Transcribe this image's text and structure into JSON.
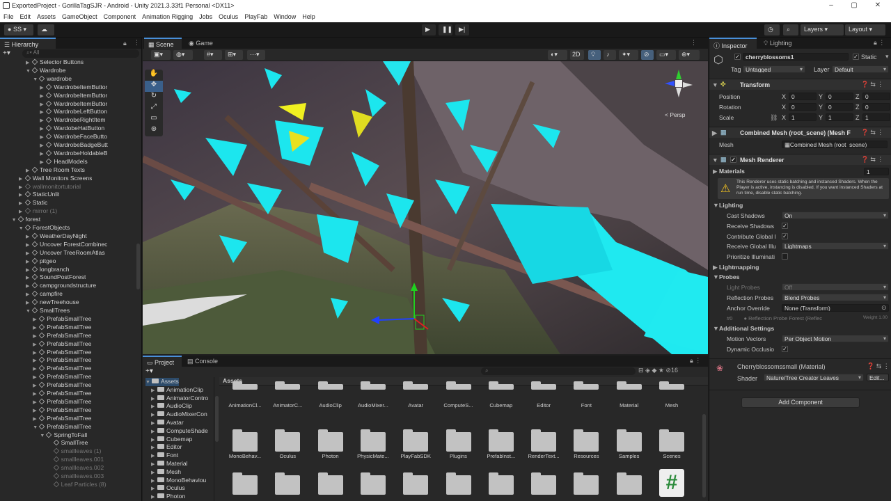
{
  "window": {
    "title": "ExportedProject - GorillaTagSJR - Android - Unity 2021.3.33f1 Personal <DX11>"
  },
  "menu": [
    "File",
    "Edit",
    "Assets",
    "GameObject",
    "Component",
    "Animation Rigging",
    "Jobs",
    "Oculus",
    "PlayFab",
    "Window",
    "Help"
  ],
  "toolbar": {
    "account": "SS",
    "layers": "Layers",
    "layout": "Layout"
  },
  "hierarchy": {
    "tab": "Hierarchy",
    "search_placeholder": "All",
    "rows": [
      {
        "label": "Selector Buttons",
        "indent": 5,
        "arrow": "▶",
        "dim": false
      },
      {
        "label": "Wardrobe",
        "indent": 5,
        "arrow": "▼",
        "dim": false
      },
      {
        "label": "wardrobe",
        "indent": 6,
        "arrow": "▼",
        "dim": false
      },
      {
        "label": "WardrobeItemButtor",
        "indent": 7,
        "arrow": "▶",
        "dim": false
      },
      {
        "label": "WardrobeItemButtor",
        "indent": 7,
        "arrow": "▶",
        "dim": false
      },
      {
        "label": "WardrobeItemButtor",
        "indent": 7,
        "arrow": "▶",
        "dim": false
      },
      {
        "label": "WardrobeLeftButton",
        "indent": 7,
        "arrow": "▶",
        "dim": false
      },
      {
        "label": "WardrobeRightItem",
        "indent": 7,
        "arrow": "▶",
        "dim": false
      },
      {
        "label": "WardobeHatButton",
        "indent": 7,
        "arrow": "▶",
        "dim": false
      },
      {
        "label": "WardrobeFaceButto",
        "indent": 7,
        "arrow": "▶",
        "dim": false
      },
      {
        "label": "WardrobeBadgeButt",
        "indent": 7,
        "arrow": "▶",
        "dim": false
      },
      {
        "label": "WardrobeHoldableB",
        "indent": 7,
        "arrow": "▶",
        "dim": false
      },
      {
        "label": "HeadModels",
        "indent": 7,
        "arrow": "▶",
        "dim": false
      },
      {
        "label": "Tree Room Texts",
        "indent": 5,
        "arrow": "▶",
        "dim": false
      },
      {
        "label": "Wall Monitors Screens",
        "indent": 4,
        "arrow": "▶",
        "dim": false
      },
      {
        "label": "wallmonitortutorial",
        "indent": 4,
        "arrow": "▶",
        "dim": true
      },
      {
        "label": "StaticUnlit",
        "indent": 4,
        "arrow": "▶",
        "dim": false
      },
      {
        "label": "Static",
        "indent": 4,
        "arrow": "▶",
        "dim": false
      },
      {
        "label": "mirror (1)",
        "indent": 4,
        "arrow": "▶",
        "dim": true
      },
      {
        "label": "forest",
        "indent": 3,
        "arrow": "▼",
        "dim": false
      },
      {
        "label": "ForestObjects",
        "indent": 4,
        "arrow": "▼",
        "dim": false
      },
      {
        "label": "WeatherDayNight",
        "indent": 5,
        "arrow": "▶",
        "dim": false
      },
      {
        "label": "Uncover ForestCombinec",
        "indent": 5,
        "arrow": "▶",
        "dim": false
      },
      {
        "label": "Uncover TreeRoomAtlas",
        "indent": 5,
        "arrow": "▶",
        "dim": false
      },
      {
        "label": "pitgeo",
        "indent": 5,
        "arrow": "▶",
        "dim": false
      },
      {
        "label": "longbranch",
        "indent": 5,
        "arrow": "▶",
        "dim": false
      },
      {
        "label": "SoundPostForest",
        "indent": 5,
        "arrow": "▶",
        "dim": false
      },
      {
        "label": "campgroundstructure",
        "indent": 5,
        "arrow": "▶",
        "dim": false
      },
      {
        "label": "campfire",
        "indent": 5,
        "arrow": "▶",
        "dim": false
      },
      {
        "label": "newTreehouse",
        "indent": 5,
        "arrow": "▶",
        "dim": false
      },
      {
        "label": "SmallTrees",
        "indent": 5,
        "arrow": "▼",
        "dim": false
      },
      {
        "label": "PrefabSmallTree",
        "indent": 6,
        "arrow": "▶",
        "dim": false
      },
      {
        "label": "PrefabSmallTree",
        "indent": 6,
        "arrow": "▶",
        "dim": false
      },
      {
        "label": "PrefabSmallTree",
        "indent": 6,
        "arrow": "▶",
        "dim": false
      },
      {
        "label": "PrefabSmallTree",
        "indent": 6,
        "arrow": "▶",
        "dim": false
      },
      {
        "label": "PrefabSmallTree",
        "indent": 6,
        "arrow": "▶",
        "dim": false
      },
      {
        "label": "PrefabSmallTree",
        "indent": 6,
        "arrow": "▶",
        "dim": false
      },
      {
        "label": "PrefabSmallTree",
        "indent": 6,
        "arrow": "▶",
        "dim": false
      },
      {
        "label": "PrefabSmallTree",
        "indent": 6,
        "arrow": "▶",
        "dim": false
      },
      {
        "label": "PrefabSmallTree",
        "indent": 6,
        "arrow": "▶",
        "dim": false
      },
      {
        "label": "PrefabSmallTree",
        "indent": 6,
        "arrow": "▶",
        "dim": false
      },
      {
        "label": "PrefabSmallTree",
        "indent": 6,
        "arrow": "▶",
        "dim": false
      },
      {
        "label": "PrefabSmallTree",
        "indent": 6,
        "arrow": "▶",
        "dim": false
      },
      {
        "label": "PrefabSmallTree",
        "indent": 6,
        "arrow": "▶",
        "dim": false
      },
      {
        "label": "PrefabSmallTree",
        "indent": 6,
        "arrow": "▼",
        "dim": false
      },
      {
        "label": "SpringToFall",
        "indent": 7,
        "arrow": "▼",
        "dim": false
      },
      {
        "label": "SmallTree",
        "indent": 8,
        "arrow": "",
        "dim": false
      },
      {
        "label": "smallleaves (1)",
        "indent": 8,
        "arrow": "",
        "dim": true
      },
      {
        "label": "smallleaves.001",
        "indent": 8,
        "arrow": "",
        "dim": true
      },
      {
        "label": "smallleaves.002",
        "indent": 8,
        "arrow": "",
        "dim": true
      },
      {
        "label": "smallleaves.003",
        "indent": 8,
        "arrow": "",
        "dim": true
      },
      {
        "label": "Leaf Particles (8)",
        "indent": 8,
        "arrow": "",
        "dim": true
      }
    ]
  },
  "scene": {
    "tabs": [
      "Scene",
      "Game"
    ],
    "btn_2d": "2D",
    "persp": "< Persp"
  },
  "project": {
    "tabs": [
      "Project",
      "Console"
    ],
    "breadcrumb": "Assets",
    "count": "16",
    "tree": [
      "Assets",
      "AnimationClip",
      "AnimatorContro",
      "AudioClip",
      "AudioMixerCon",
      "Avatar",
      "ComputeShade",
      "Cubemap",
      "Editor",
      "Font",
      "Material",
      "Mesh",
      "MonoBehaviou",
      "Oculus",
      "Photon"
    ],
    "row1": [
      "AnimationCl...",
      "AnimatorC...",
      "AudioClip",
      "AudioMixer...",
      "Avatar",
      "ComputeS...",
      "Cubemap",
      "Editor",
      "Font",
      "Material",
      "Mesh"
    ],
    "row2": [
      "MonoBehav...",
      "Oculus",
      "Photon",
      "PhysicMate...",
      "PlayFabSDK",
      "Plugins",
      "PrefabInst...",
      "RenderText...",
      "Resources",
      "Samples",
      "Scenes"
    ]
  },
  "inspector": {
    "tabs": [
      "Inspector",
      "Lighting"
    ],
    "object_name": "cherryblossoms1",
    "static_label": "Static",
    "tag_label": "Tag",
    "tag_value": "Untagged",
    "layer_label": "Layer",
    "layer_value": "Default",
    "transform": {
      "title": "Transform",
      "position": "Position",
      "rotation": "Rotation",
      "scale": "Scale",
      "pos": [
        "0",
        "0",
        "0"
      ],
      "rot": [
        "0",
        "0",
        "0"
      ],
      "scl": [
        "1",
        "1",
        "1"
      ]
    },
    "mesh_filter": {
      "title": "Combined Mesh (root_scene) (Mesh F",
      "mesh_label": "Mesh",
      "mesh_value": "Combined Mesh (root_scene)"
    },
    "renderer": {
      "title": "Mesh Renderer",
      "materials": "Materials",
      "materials_count": "1",
      "warning": "This Renderer uses static batching and instanced Shaders. When the Player is active, instancing is disabled. If you want instanced Shaders at run time, disable static batching.",
      "lighting": "Lighting",
      "cast_shadows": "Cast Shadows",
      "cast_shadows_value": "On",
      "receive_shadows": "Receive Shadows",
      "contribute_gi": "Contribute Global I",
      "receive_gi": "Receive Global Illu",
      "receive_gi_value": "Lightmaps",
      "prioritize": "Prioritize Illuminati",
      "lightmapping": "Lightmapping",
      "probes": "Probes",
      "light_probes": "Light Probes",
      "light_probes_value": "Off",
      "reflection_probes": "Reflection Probes",
      "reflection_probes_value": "Blend Probes",
      "anchor": "Anchor Override",
      "anchor_value": "None (Transform)",
      "probe_hash": "#0",
      "probe_ref": "Reflection Probe Forest (Reflec",
      "probe_weight": "Weight 1.00",
      "additional": "Additional Settings",
      "motion_vectors": "Motion Vectors",
      "motion_vectors_value": "Per Object Motion",
      "dynamic_occlusion": "Dynamic Occlusio"
    },
    "material": {
      "title": "Cherryblossomssmall (Material)",
      "shader_label": "Shader",
      "shader_value": "Nature/Tree Creator Leaves",
      "edit": "Edit..."
    },
    "add_component": "Add Component"
  }
}
